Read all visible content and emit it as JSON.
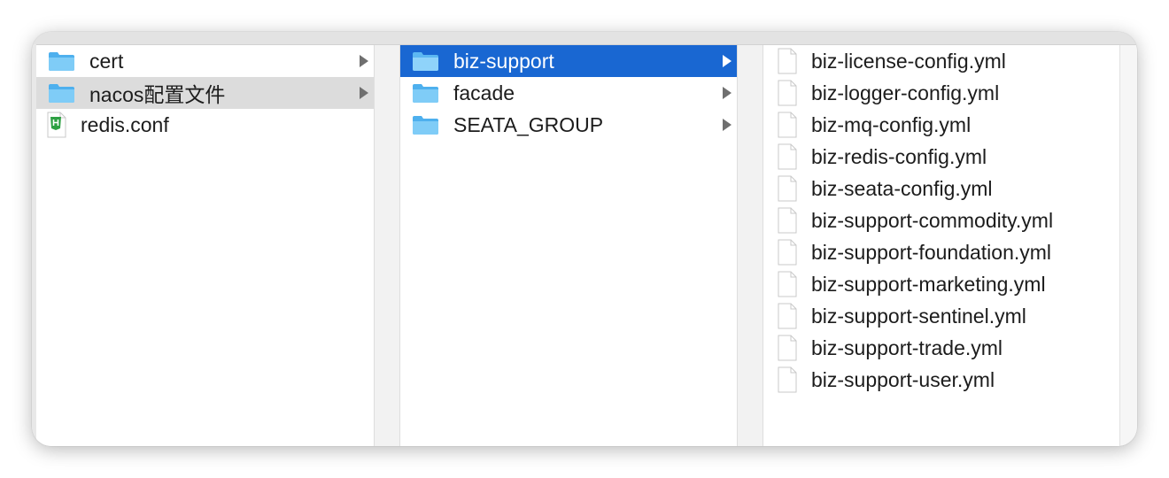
{
  "columns": [
    {
      "items": [
        {
          "label": "cert",
          "kind": "folder",
          "state": "normal"
        },
        {
          "label": "nacos配置文件",
          "kind": "folder",
          "state": "selected-inactive"
        },
        {
          "label": "redis.conf",
          "kind": "file-html",
          "state": "normal"
        }
      ]
    },
    {
      "items": [
        {
          "label": "biz-support",
          "kind": "folder",
          "state": "selected-active"
        },
        {
          "label": "facade",
          "kind": "folder",
          "state": "normal"
        },
        {
          "label": "SEATA_GROUP",
          "kind": "folder",
          "state": "normal"
        }
      ]
    },
    {
      "items": [
        {
          "label": "biz-license-config.yml",
          "kind": "file"
        },
        {
          "label": "biz-logger-config.yml",
          "kind": "file"
        },
        {
          "label": "biz-mq-config.yml",
          "kind": "file"
        },
        {
          "label": "biz-redis-config.yml",
          "kind": "file"
        },
        {
          "label": "biz-seata-config.yml",
          "kind": "file"
        },
        {
          "label": "biz-support-commodity.yml",
          "kind": "file"
        },
        {
          "label": "biz-support-foundation.yml",
          "kind": "file"
        },
        {
          "label": "biz-support-marketing.yml",
          "kind": "file"
        },
        {
          "label": "biz-support-sentinel.yml",
          "kind": "file"
        },
        {
          "label": "biz-support-trade.yml",
          "kind": "file"
        },
        {
          "label": "biz-support-user.yml",
          "kind": "file"
        }
      ]
    }
  ],
  "colors": {
    "selection_active": "#1967d2",
    "selection_inactive": "#dcdcdc",
    "folder": "#6cc3f5",
    "html_badge": "#2ea043"
  },
  "icons": {
    "folder": "folder-icon",
    "file": "document-icon",
    "file_html": "html-file-icon",
    "disclosure": "chevron-right-icon"
  }
}
